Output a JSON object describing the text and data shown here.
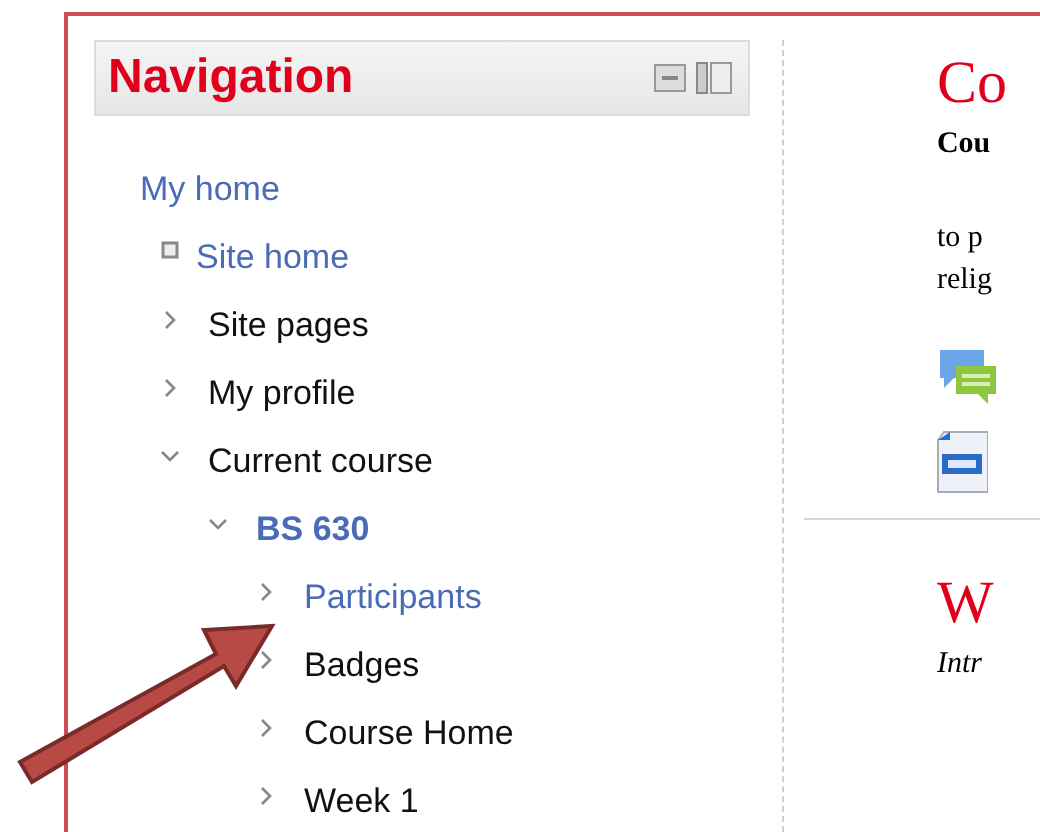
{
  "navigation": {
    "title": "Navigation",
    "items": [
      {
        "label": "My home",
        "kind": "link",
        "children": [
          {
            "label": "Site home",
            "kind": "leaf-link"
          },
          {
            "label": "Site pages",
            "kind": "branch",
            "expanded": false
          },
          {
            "label": "My profile",
            "kind": "branch",
            "expanded": false
          },
          {
            "label": "Current course",
            "kind": "branch",
            "expanded": true,
            "children": [
              {
                "label": "BS 630",
                "kind": "course",
                "expanded": true,
                "children": [
                  {
                    "label": "Participants",
                    "kind": "branch-link",
                    "expanded": false
                  },
                  {
                    "label": "Badges",
                    "kind": "branch",
                    "expanded": false
                  },
                  {
                    "label": "Course Home",
                    "kind": "branch",
                    "expanded": false
                  },
                  {
                    "label": "Week 1",
                    "kind": "branch",
                    "expanded": false
                  }
                ]
              }
            ]
          }
        ]
      }
    ]
  },
  "content": {
    "heading_1": "Co",
    "subtitle": "Cou",
    "line_1": "to p",
    "line_2": "relig",
    "heading_2": "W",
    "intro": "Intr"
  }
}
